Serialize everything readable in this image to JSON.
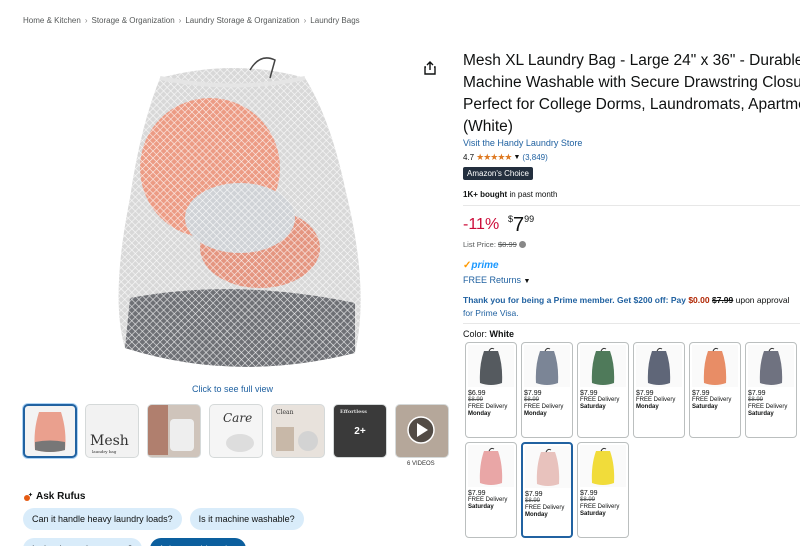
{
  "breadcrumb": [
    "Home & Kitchen",
    "Storage & Organization",
    "Laundry Storage & Organization",
    "Laundry Bags"
  ],
  "gallery": {
    "see_full": "Click to see full view",
    "thumb_texts": [
      "Mesh",
      "laundry bag",
      "Care",
      "Laundry",
      "Clean",
      "Effortless",
      "2+"
    ],
    "videos_label": "6 VIDEOS"
  },
  "rufus": {
    "label": "Ask Rufus",
    "chips": [
      "Can it handle heavy laundry loads?",
      "Is it machine washable?",
      "Is the drawstring secure?",
      "Ask something else"
    ]
  },
  "product": {
    "title": "Mesh XL Laundry Bag - Large 24\" x 36\" - Durable Machine Washable with Secure Drawstring Closure - Perfect for College Dorms, Laundromats, Apartments (White)",
    "store": "Visit the Handy Laundry Store",
    "rating": "4.7",
    "stars": "★★★★★",
    "rating_count": "(3,849)",
    "badge": "Amazon's Choice",
    "bought_bold": "1K+ bought",
    "bought_rest": " in past month",
    "discount": "-11%",
    "price_symbol": "$",
    "price_whole": "7",
    "price_fraction": "99",
    "list_price_label": "List Price: ",
    "list_price": "$8.99",
    "prime": "prime",
    "free_returns": "FREE Returns",
    "prime_msg_1": "Thank you for being a Prime member. Get $200 off: Pay ",
    "prime_msg_pay": "$0.00",
    "prime_msg_old": "$7.99",
    "prime_msg_2": " upon approval",
    "prime_msg_3": "for Prime Visa.",
    "color_label": "Color: ",
    "color_value": "White"
  },
  "swatches": [
    {
      "color": "#555a5f",
      "price": "$6.99",
      "old": "$8.99",
      "l1": "FREE Delivery",
      "l2": "Monday"
    },
    {
      "color": "#7b8596",
      "price": "$7.99",
      "old": "$8.99",
      "l1": "FREE Delivery",
      "l2": "Monday"
    },
    {
      "color": "#4f7a5a",
      "price": "$7.99",
      "old": "",
      "l1": "FREE Delivery",
      "l2": "Saturday"
    },
    {
      "color": "#5f6678",
      "price": "$7.99",
      "old": "",
      "l1": "FREE Delivery",
      "l2": "Monday"
    },
    {
      "color": "#e88d66",
      "price": "$7.99",
      "old": "",
      "l1": "FREE Delivery",
      "l2": "Saturday"
    },
    {
      "color": "#6f7280",
      "price": "$7.99",
      "old": "$8.99",
      "l1": "FREE Delivery",
      "l2": "Saturday"
    },
    {
      "color": "#e9a6a6",
      "price": "$7.99",
      "old": "",
      "l1": "FREE Delivery",
      "l2": "Saturday"
    },
    {
      "color": "#e8c2bd",
      "price": "$7.99",
      "old": "$8.99",
      "l1": "FREE Delivery",
      "l2": "Monday"
    },
    {
      "color": "#f1dc3a",
      "price": "$7.99",
      "old": "$8.99",
      "l1": "FREE Delivery",
      "l2": "Saturday"
    }
  ]
}
